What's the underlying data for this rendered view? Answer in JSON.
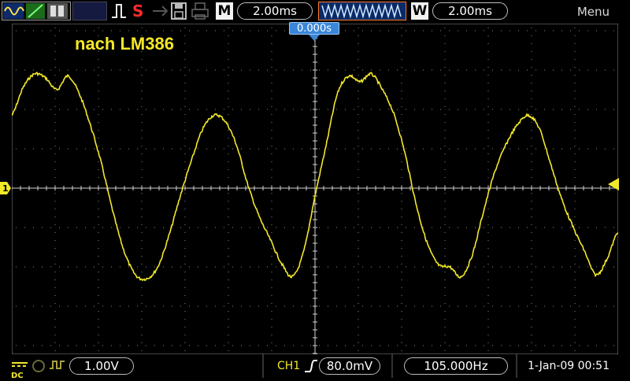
{
  "toolbar": {
    "run_mode_icon": "acquire-mode-icon",
    "stop_icon": "trigger-edge-icon",
    "status_letter": "S",
    "m_label": "M",
    "timebase": "2.00ms",
    "w_label": "W",
    "window_timebase": "2.00ms",
    "menu_label": "Menu"
  },
  "screen": {
    "annotation": "nach LM386",
    "trigger_time": "0.000s",
    "channel_marker": "1",
    "trace_color": "#f2e82a",
    "grid_color": "#8a8a8a"
  },
  "bottom": {
    "coupling": "DC",
    "ch1_scale": "1.00V",
    "trigger_channel": "CH1",
    "trigger_level": "80.0mV",
    "frequency": "105.000Hz",
    "datetime": "1-Jan-09 00:51"
  },
  "waveform": {
    "description_samples_volts": [
      1.85,
      2.55,
      2.9,
      2.8,
      2.5,
      2.85,
      2.4,
      1.6,
      0.6,
      -0.6,
      -1.6,
      -2.2,
      -2.3,
      -2.0,
      -1.2,
      -0.2,
      0.7,
      1.5,
      1.85,
      1.7,
      1.1,
      0.1,
      -0.7,
      -1.3,
      -1.9,
      -2.25,
      -1.6,
      -0.2,
      1.1,
      2.4,
      2.85,
      2.7,
      2.9,
      2.5,
      1.9,
      0.9,
      -0.4,
      -1.4,
      -1.95,
      -2.0,
      -2.25,
      -1.7,
      -0.6,
      0.4,
      1.1,
      1.6,
      1.85,
      1.5,
      0.6,
      -0.3,
      -1.0,
      -1.6,
      -2.2,
      -1.8,
      -1.1
    ]
  }
}
